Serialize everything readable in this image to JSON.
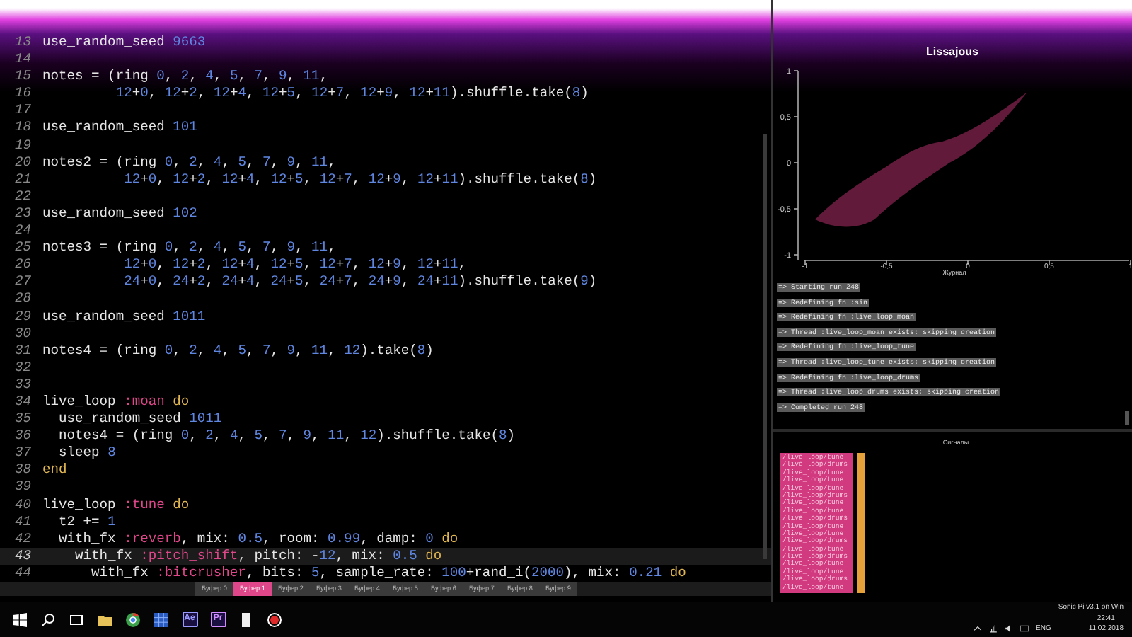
{
  "editor": {
    "lines": [
      {
        "number": "13",
        "text": "use_random_seed 9663",
        "current": false
      },
      {
        "number": "14",
        "current": false
      },
      {
        "number": "15",
        "text": "notes = (ring 0, 2, 4, 5, 7, 9, 11,",
        "current": false
      },
      {
        "number": "16",
        "text": "         12+0, 12+2, 12+4, 12+5, 12+7, 12+9, 12+11).shuffle.take(8)",
        "current": false
      },
      {
        "number": "17",
        "current": false
      },
      {
        "number": "18",
        "text": "use_random_seed 101",
        "current": false
      },
      {
        "number": "19",
        "current": false
      },
      {
        "number": "20",
        "text": "notes2 = (ring 0, 2, 4, 5, 7, 9, 11,",
        "current": false
      },
      {
        "number": "21",
        "text": "          12+0, 12+2, 12+4, 12+5, 12+7, 12+9, 12+11).shuffle.take(8)",
        "current": false
      },
      {
        "number": "22",
        "current": false
      },
      {
        "number": "23",
        "text": "use_random_seed 102",
        "current": false
      },
      {
        "number": "24",
        "current": false
      },
      {
        "number": "25",
        "text": "notes3 = (ring 0, 2, 4, 5, 7, 9, 11,",
        "current": false
      },
      {
        "number": "26",
        "text": "          12+0, 12+2, 12+4, 12+5, 12+7, 12+9, 12+11,",
        "current": false
      },
      {
        "number": "27",
        "text": "          24+0, 24+2, 24+4, 24+5, 24+7, 24+9, 24+11).shuffle.take(9)",
        "current": false
      },
      {
        "number": "28",
        "current": false
      },
      {
        "number": "29",
        "text": "use_random_seed 1011",
        "current": false
      },
      {
        "number": "30",
        "current": false
      },
      {
        "number": "31",
        "text": "notes4 = (ring 0, 2, 4, 5, 7, 9, 11, 12).take(8)",
        "current": false
      },
      {
        "number": "32",
        "current": false
      },
      {
        "number": "33",
        "current": false
      },
      {
        "number": "34",
        "text": "live_loop :moan do",
        "current": false
      },
      {
        "number": "35",
        "text": "  use_random_seed 1011",
        "current": false
      },
      {
        "number": "36",
        "text": "  notes4 = (ring 0, 2, 4, 5, 7, 9, 11, 12).shuffle.take(8)",
        "current": false
      },
      {
        "number": "37",
        "text": "  sleep 8",
        "current": false
      },
      {
        "number": "38",
        "text": "end",
        "current": false
      },
      {
        "number": "39",
        "current": false
      },
      {
        "number": "40",
        "text": "live_loop :tune do",
        "current": false
      },
      {
        "number": "41",
        "text": "  t2 += 1",
        "current": false
      },
      {
        "number": "42",
        "text": "  with_fx :reverb, mix: 0.5, room: 0.99, damp: 0 do",
        "current": false
      },
      {
        "number": "43",
        "text": "    with_fx :pitch_shift, pitch: -12, mix: 0.5 do",
        "current": true
      },
      {
        "number": "44",
        "text": "      with_fx :bitcrusher, bits: 5, sample_rate: 100+rand_i(2000), mix: 0.21 do",
        "current": false
      }
    ]
  },
  "buffer_tabs": [
    {
      "label": "Буфер 0",
      "selected": false
    },
    {
      "label": "Буфер 1",
      "selected": true
    },
    {
      "label": "Буфер 2",
      "selected": false
    },
    {
      "label": "Буфер 3",
      "selected": false
    },
    {
      "label": "Буфер 4",
      "selected": false
    },
    {
      "label": "Буфер 5",
      "selected": false
    },
    {
      "label": "Буфер 6",
      "selected": false
    },
    {
      "label": "Буфер 7",
      "selected": false
    },
    {
      "label": "Буфер 8",
      "selected": false
    },
    {
      "label": "Буфер 9",
      "selected": false
    }
  ],
  "scope": {
    "title": "Lissajous",
    "y_ticks": [
      "1",
      "0,5",
      "0",
      "-0,5",
      "-1"
    ],
    "x_ticks": [
      "-1",
      "-0,5",
      "0",
      "0,5",
      "1"
    ]
  },
  "log": {
    "title": "Журнал",
    "lines": [
      "=> Starting run 248",
      "=> Redefining fn :sin",
      "=> Redefining fn :live_loop_moan",
      "=> Thread :live_loop_moan exists: skipping creation",
      "=> Redefining fn :live_loop_tune",
      "=> Thread :live_loop_tune exists: skipping creation",
      "=> Redefining fn :live_loop_drums",
      "=> Thread :live_loop_drums exists: skipping creation",
      "=> Completed run 248"
    ]
  },
  "cues": {
    "title": "Сигналы",
    "items": [
      "/live_loop/tune",
      "/live_loop/drums",
      "/live_loop/tune",
      "/live_loop/tune",
      "/live_loop/tune",
      "/live_loop/drums",
      "/live_loop/tune",
      "/live_loop/tune",
      "/live_loop/drums",
      "/live_loop/tune",
      "/live_loop/tune",
      "/live_loop/drums",
      "/live_loop/tune",
      "/live_loop/drums",
      "/live_loop/tune",
      "/live_loop/tune",
      "/live_loop/drums",
      "/live_loop/tune"
    ]
  },
  "taskbar": {
    "apps": [
      {
        "kind": "folder"
      },
      {
        "kind": "browser"
      },
      {
        "kind": "grid"
      },
      {
        "kind": "letters",
        "label": "Ae",
        "color": "#9999ff"
      },
      {
        "kind": "letters",
        "label": "Pr",
        "color": "#d08cff"
      },
      {
        "kind": "page"
      },
      {
        "kind": "record"
      }
    ],
    "tray": {
      "app_label": "Sonic Pi v3.1 on Win",
      "language": "ENG",
      "time": "22:41",
      "date": "11.02.2018"
    }
  }
}
